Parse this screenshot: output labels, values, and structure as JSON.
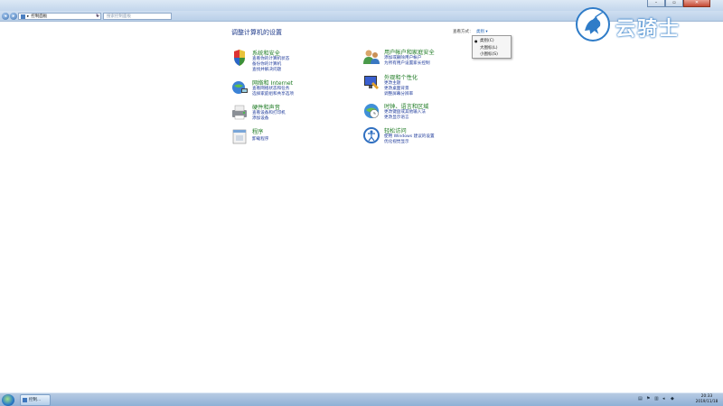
{
  "window": {
    "minimize": "–",
    "maximize": "▫",
    "close": "✕"
  },
  "address": {
    "back": "◂",
    "forward": "▸",
    "path": "控制面板",
    "path_sep": "▸",
    "dropdown": "▾",
    "refresh": "↻",
    "search_placeholder": "搜索控制面板"
  },
  "main": {
    "title": "调整计算机的设置",
    "view_by_label": "查看方式：",
    "view_by_value": "类别 ▾"
  },
  "view_menu": {
    "items": [
      "类别(C)",
      "大图标(L)",
      "小图标(S)"
    ],
    "selected_index": 0,
    "bullet": "●"
  },
  "categories": [
    {
      "name": "system-security",
      "title": "系统和安全",
      "icon": "shield-pc-icon",
      "links": [
        "查看你的计算机状态",
        "备份你的计算机",
        "查找并解决问题"
      ]
    },
    {
      "name": "network-internet",
      "title": "网络和 Internet",
      "icon": "globe-network-icon",
      "links": [
        "查看网络状态和任务",
        "选择家庭组和共享选项"
      ]
    },
    {
      "name": "hardware-sound",
      "title": "硬件和声音",
      "icon": "printer-icon",
      "links": [
        "查看设备和打印机",
        "添加设备"
      ]
    },
    {
      "name": "programs",
      "title": "程序",
      "icon": "programs-icon",
      "links": [
        "卸载程序"
      ]
    },
    {
      "name": "user-accounts",
      "title": "用户帐户和家庭安全",
      "icon": "users-icon",
      "links": [
        "添加或删除用户帐户",
        "为所有用户设置家长控制"
      ]
    },
    {
      "name": "appearance",
      "title": "外观和个性化",
      "icon": "monitor-paint-icon",
      "links": [
        "更改主题",
        "更改桌面背景",
        "调整屏幕分辨率"
      ]
    },
    {
      "name": "clock-language",
      "title": "时钟、语言和区域",
      "icon": "clock-globe-icon",
      "links": [
        "更改键盘或其他输入法",
        "更改显示语言"
      ]
    },
    {
      "name": "ease-of-access",
      "title": "轻松访问",
      "icon": "accessibility-icon",
      "links": [
        "使用 Windows 建议的设置",
        "优化视觉显示"
      ]
    }
  ],
  "taskbar": {
    "app_label": "控制...",
    "time": "20:33",
    "date": "2019/11/18"
  },
  "watermark": {
    "text": "云骑士"
  },
  "colors": {
    "category_title": "#1d7a23",
    "link": "#1e3a9a",
    "watermark_blue": "#2f7cc8"
  }
}
